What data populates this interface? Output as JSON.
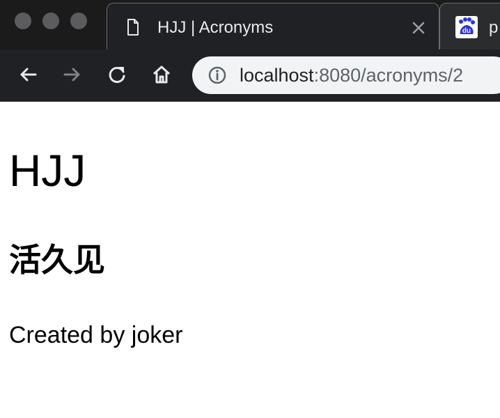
{
  "browser": {
    "active_tab": {
      "title": "HJJ | Acronyms"
    },
    "inactive_tab": {
      "title_fragment": "p",
      "favicon_text": "du",
      "favicon_color": "#2932e1"
    },
    "address_bar": {
      "host": "localhost",
      "path": ":8080/acronyms/2"
    },
    "icons": {
      "tab_page": "document-icon",
      "tab_close": "close-icon",
      "back": "back-arrow-icon",
      "forward": "forward-arrow-icon",
      "reload": "reload-icon",
      "home": "home-icon",
      "site_info": "info-icon"
    },
    "colors": {
      "chrome_dark": "#202124",
      "text_light": "#e8eaed",
      "omnibox": "#f1f3f4",
      "url_muted": "#5f6368"
    }
  },
  "page": {
    "heading": "HJJ",
    "subheading": "活久见",
    "creator_text": "Created by joker"
  }
}
